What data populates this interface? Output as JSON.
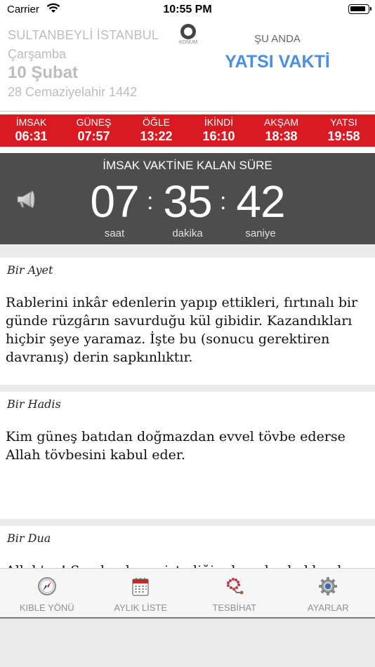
{
  "status_bar": {
    "carrier": "Carrier",
    "time": "10:55 PM"
  },
  "header": {
    "location": "SULTANBEYLİ İSTANBUL",
    "weekday": "Çarşamba",
    "date": "10 Şubat",
    "hijri_date": "28 Cemaziyelahir 1442",
    "konum_label": "KONUM",
    "now_label": "ŞU ANDA",
    "current_prayer": "YATSI VAKTİ",
    "accent_color": "#4a8fe0"
  },
  "prayer_times": {
    "bar_color": "#da1a22",
    "items": [
      {
        "name": "İMSAK",
        "time": "06:31"
      },
      {
        "name": "GÜNEŞ",
        "time": "07:57"
      },
      {
        "name": "ÖĞLE",
        "time": "13:22"
      },
      {
        "name": "İKİNDİ",
        "time": "16:10"
      },
      {
        "name": "AKŞAM",
        "time": "18:38"
      },
      {
        "name": "YATSI",
        "time": "19:58"
      }
    ]
  },
  "countdown": {
    "title": "İMSAK VAKTİNE KALAN SÜRE",
    "hours": "07",
    "minutes": "35",
    "seconds": "42",
    "separator": ":",
    "hours_label": "saat",
    "minutes_label": "dakika",
    "seconds_label": "saniye"
  },
  "cards": {
    "ayet": {
      "title": "Bir Ayet",
      "text": "Rablerini inkâr edenlerin yapıp ettikleri, fırtınalı bir günde rüzgârın savurduğu kül gibidir. Kazandıkları hiçbir şeye yaramaz. İşte bu (sonucu gerektiren davranış) derin sapkınlıktır."
    },
    "hadis": {
      "title": "Bir Hadis",
      "text": "Kim güneş batıdan doğmazdan evvel tövbe ederse Allah tövbesini kabul eder."
    },
    "dua": {
      "title": "Bir Dua",
      "text": "Allah'ım! Senden hayır istediğim konular hakkında bana hayırlısını"
    }
  },
  "tab_bar": {
    "tabs": [
      {
        "label": "KIBLE YÖNÜ",
        "icon": "compass-icon"
      },
      {
        "label": "AYLIK LİSTE",
        "icon": "calendar-icon"
      },
      {
        "label": "TESBİHAT",
        "icon": "prayer-beads-icon"
      },
      {
        "label": "AYARLAR",
        "icon": "gear-icon"
      }
    ]
  }
}
